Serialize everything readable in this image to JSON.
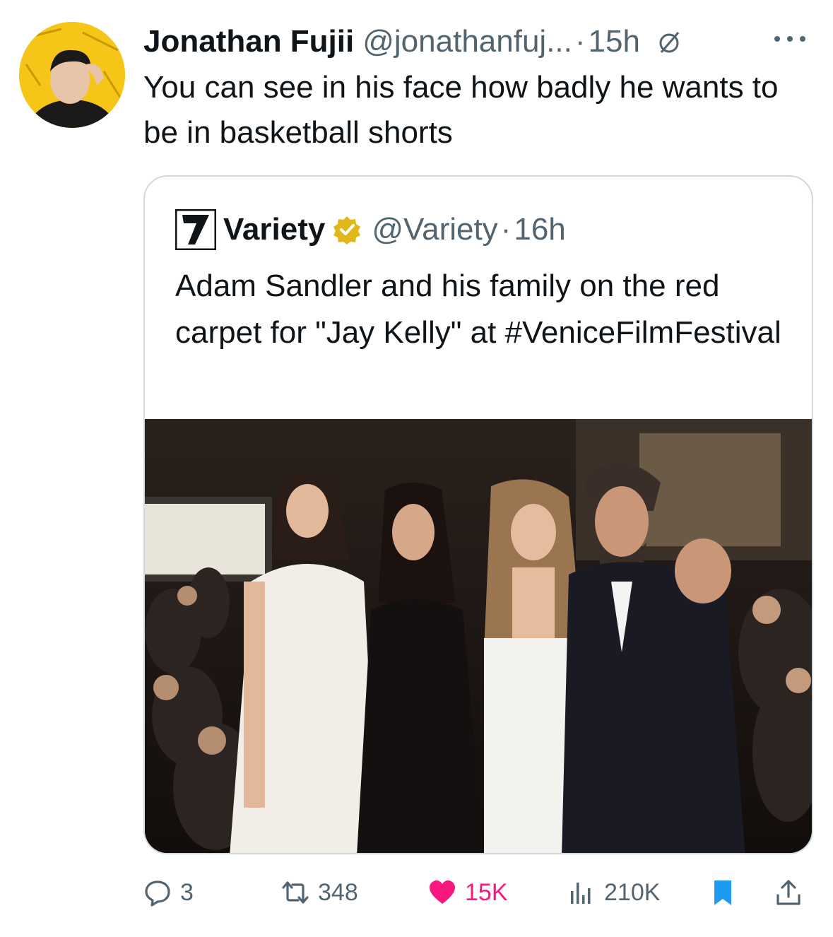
{
  "tweet": {
    "display_name": "Jonathan Fujii",
    "handle": "@jonathanfuj...",
    "separator": "·",
    "time": "15h",
    "text": "You can see in his face how badly he wants to be in basketball shorts",
    "avatar_icon": "avatar-photo",
    "more_icon": "more-horizontal-icon",
    "not_allowed_icon": "slashed-circle-icon"
  },
  "quote": {
    "display_name": "Variety",
    "handle": "@Variety",
    "separator": "·",
    "time": "16h",
    "verified": true,
    "text": "Adam Sandler and his family on the red carpet for \"Jay Kelly\" at #VeniceFilmFestival",
    "logo_icon": "variety-v-logo"
  },
  "actions": {
    "replies": "3",
    "retweets": "348",
    "likes": "15K",
    "views": "210K"
  },
  "colors": {
    "text_primary": "#0f1419",
    "text_secondary": "#536471",
    "like_pink": "#f91880",
    "bookmark_blue": "#1d9bf0",
    "verified_gold": "#e2b719",
    "border": "#cfd9de",
    "avatar_bg": "#f5c518"
  }
}
